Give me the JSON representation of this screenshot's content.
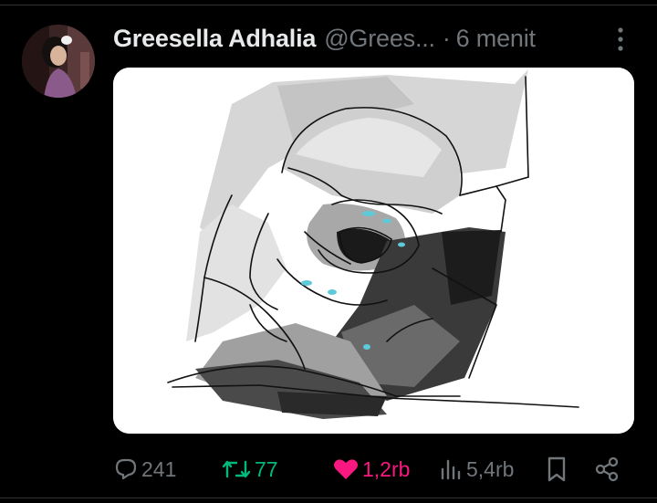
{
  "post": {
    "author": {
      "display_name": "Greesella Adhalia",
      "handle": "@Grees...",
      "avatar_icon": "profile-photo"
    },
    "separator": "·",
    "timestamp": "6 menit",
    "more_icon": "more-vertical-icon",
    "media": {
      "kind": "drawing",
      "background": "#ffffff"
    },
    "actions": {
      "reply": {
        "icon": "reply-icon",
        "count": "241"
      },
      "retweet": {
        "icon": "retweet-icon",
        "count": "77",
        "color": "#00ba7c"
      },
      "like": {
        "icon": "heart-icon",
        "count": "1,2rb",
        "color": "#f91880"
      },
      "views": {
        "icon": "views-icon",
        "count": "5,4rb"
      },
      "bookmark": {
        "icon": "bookmark-icon"
      },
      "share": {
        "icon": "share-icon"
      }
    }
  },
  "theme": {
    "background": "#000000",
    "text_primary": "#e7e9ea",
    "text_secondary": "#71767b",
    "divider": "#2f3336"
  }
}
